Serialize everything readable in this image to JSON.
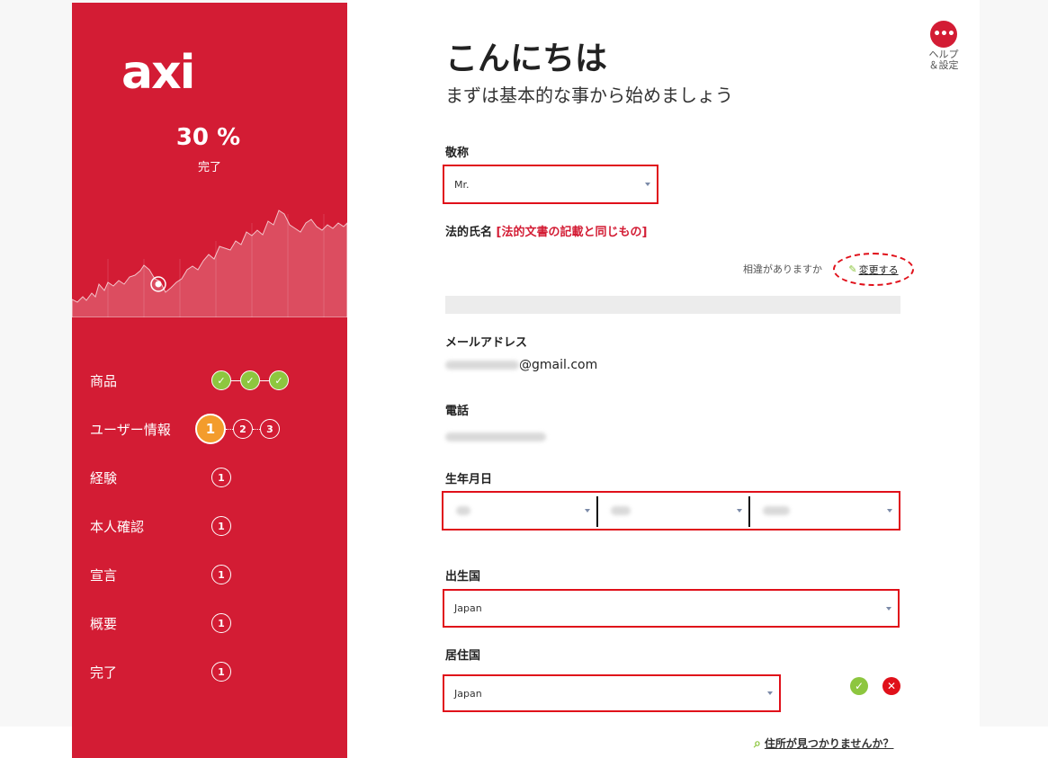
{
  "sidebar": {
    "logo": "axi",
    "progress_pct": "30 %",
    "progress_label": "完了",
    "progress_value": 30,
    "steps": [
      {
        "label": "商品",
        "indicators": [
          "done",
          "done",
          "done"
        ]
      },
      {
        "label": "ユーザー情報",
        "indicators": [
          "1",
          "2",
          "3"
        ]
      },
      {
        "label": "経験",
        "indicators": [
          "1"
        ]
      },
      {
        "label": "本人確認",
        "indicators": [
          "1"
        ]
      },
      {
        "label": "宣言",
        "indicators": [
          "1"
        ]
      },
      {
        "label": "概要",
        "indicators": [
          "1"
        ]
      },
      {
        "label": "完了",
        "indicators": [
          "1"
        ]
      }
    ]
  },
  "header": {
    "title": "こんにちは",
    "subtitle": "まずは基本的な事から始めましょう",
    "help_icon": "more-dots-icon",
    "help_label_1": "ヘルプ",
    "help_label_2": "＆設定"
  },
  "form": {
    "honorific": {
      "label": "敬称",
      "value": "Mr."
    },
    "legal_name": {
      "label": "法的氏名",
      "note": "[法的文書の記載と同じもの]",
      "discrepancy_text": "相違がありますか",
      "change_label": "変更する"
    },
    "email": {
      "label": "メールアドレス",
      "value_suffix": "@gmail.com"
    },
    "phone": {
      "label": "電話"
    },
    "birth_date": {
      "label": "生年月日"
    },
    "birth_country": {
      "label": "出生国",
      "value": "Japan"
    },
    "residence_country": {
      "label": "居住国",
      "value": "Japan"
    },
    "address_link": "住所が見つかりませんか？"
  },
  "colors": {
    "brand_red": "#d31c34",
    "highlight_red": "#e0101a",
    "success_green": "#8dc63f",
    "active_orange": "#f39c2c"
  }
}
